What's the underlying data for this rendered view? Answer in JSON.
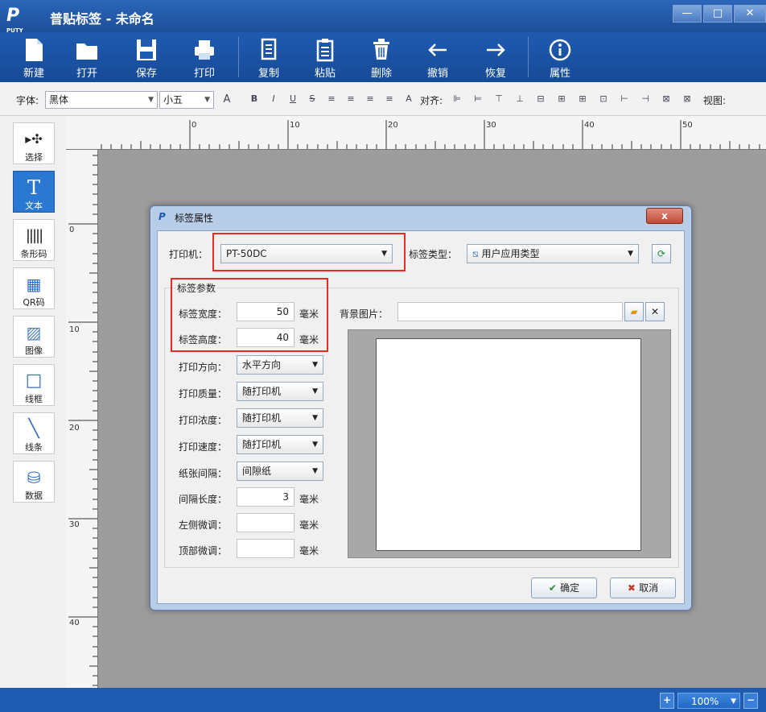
{
  "window": {
    "logo_text": "P",
    "logo_small": "PUTY",
    "title": "普贴标签 - 未命名",
    "minimize": "—",
    "restore": "□",
    "close": "✕"
  },
  "ribbon": {
    "items": [
      {
        "label": "新建",
        "icon": "new-file-icon"
      },
      {
        "label": "打开",
        "icon": "folder-icon"
      },
      {
        "label": "保存",
        "icon": "save-icon"
      },
      {
        "label": "打印",
        "icon": "printer-icon"
      },
      {
        "label": "复制",
        "icon": "copy-icon"
      },
      {
        "label": "粘贴",
        "icon": "paste-icon"
      },
      {
        "label": "删除",
        "icon": "trash-icon"
      },
      {
        "label": "撤销",
        "icon": "undo-arrow-icon"
      },
      {
        "label": "恢复",
        "icon": "redo-arrow-icon"
      },
      {
        "label": "属性",
        "icon": "info-icon"
      }
    ]
  },
  "formatbar": {
    "font_label": "字体:",
    "font_value": "黑体",
    "size_value": "小五",
    "align_label": "对齐:",
    "view_label": "视图:",
    "format_buttons": [
      "A",
      "B",
      "I",
      "U",
      "S",
      "≡",
      "≡",
      "≡",
      "≡",
      "A"
    ],
    "align_buttons": [
      "⊫",
      "⊨",
      "⊤",
      "⊥",
      "⊟",
      "⊞",
      "⊞",
      "⊡",
      "⊢",
      "⊣",
      "⊠",
      "⊠"
    ]
  },
  "toolbox": {
    "items": [
      {
        "label": "选择",
        "icon": "pointer-icon"
      },
      {
        "label": "文本",
        "icon": "text-icon"
      },
      {
        "label": "条形码",
        "icon": "barcode-icon"
      },
      {
        "label": "QR码",
        "icon": "qrcode-icon"
      },
      {
        "label": "图像",
        "icon": "image-icon"
      },
      {
        "label": "线框",
        "icon": "rectangle-icon"
      },
      {
        "label": "线条",
        "icon": "line-icon"
      },
      {
        "label": "数据",
        "icon": "database-icon"
      }
    ]
  },
  "ruler": {
    "h_labels": [
      "0",
      "10",
      "20",
      "30",
      "40",
      "50"
    ],
    "v_labels": [
      "0",
      "10",
      "20",
      "30",
      "40"
    ]
  },
  "status": {
    "zoom": "100%",
    "zoom_in": "+",
    "zoom_out": "−"
  },
  "dialog": {
    "title": "标签属性",
    "close": "x",
    "printer_label": "打印机：",
    "printer_value": "PT-50DC",
    "label_type_label": "标签类型：",
    "label_type_value": "用户应用类型",
    "group_title": "标签参数",
    "width_label": "标签宽度：",
    "width_value": "50",
    "height_label": "标签高度：",
    "height_value": "40",
    "unit": "毫米",
    "bg_image_label": "背景图片：",
    "bg_image_value": "",
    "direction_label": "打印方向：",
    "direction_value": "水平方向",
    "quality_label": "打印质量：",
    "quality_value": "随打印机",
    "density_label": "打印浓度：",
    "density_value": "随打印机",
    "speed_label": "打印速度：",
    "speed_value": "随打印机",
    "gap_label": "纸张间隔：",
    "gap_value": "间隙纸",
    "gap_len_label": "间隔长度：",
    "gap_len_value": "3",
    "left_adj_label": "左侧微调：",
    "left_adj_value": "",
    "top_adj_label": "顶部微调：",
    "top_adj_value": "",
    "ok": "确定",
    "cancel": "取消"
  }
}
